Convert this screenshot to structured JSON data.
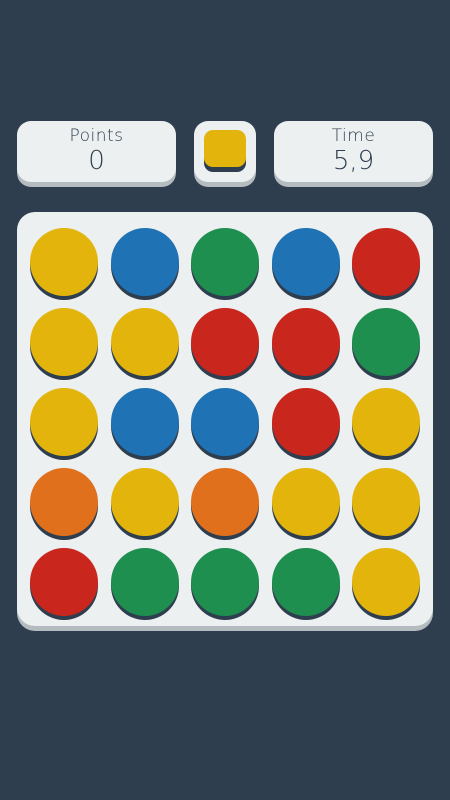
{
  "hud": {
    "points_label": "Points",
    "points_value": "0",
    "time_label": "Time",
    "time_value": "5,9",
    "target_color": "yellow"
  },
  "colors": {
    "yellow": "#e2b40c",
    "blue": "#1f72b4",
    "green": "#1e8f4e",
    "red": "#c9261e",
    "orange": "#e1701c"
  },
  "board": {
    "rows": [
      [
        "yellow",
        "blue",
        "green",
        "blue",
        "red"
      ],
      [
        "yellow",
        "yellow",
        "red",
        "red",
        "green"
      ],
      [
        "yellow",
        "blue",
        "blue",
        "red",
        "yellow"
      ],
      [
        "orange",
        "yellow",
        "orange",
        "yellow",
        "yellow"
      ],
      [
        "red",
        "green",
        "green",
        "green",
        "yellow"
      ]
    ]
  }
}
